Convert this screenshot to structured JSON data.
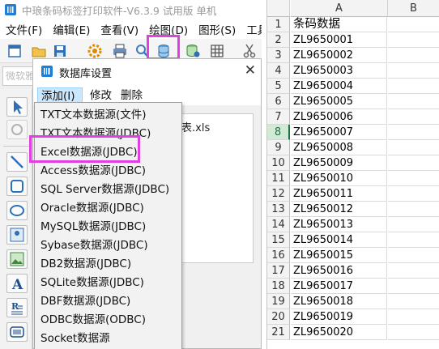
{
  "app": {
    "title": "中琅条码标签打印软件-V6.3.9 试用版 单机",
    "menu": [
      "文件(F)",
      "编辑(E)",
      "查看(V)",
      "绘图(D)",
      "图形(S)",
      "工具"
    ],
    "font_box_text": "微软雅黑"
  },
  "dialog": {
    "title": "数据库设置",
    "close_label": "✕",
    "menu": {
      "add": "添加(I)",
      "modify": "修改",
      "delete": "删除"
    },
    "file_text": "表.xls",
    "dropdown_items": [
      "TXT文本数据源(文件)",
      "TXT文本数据源(JDBC)",
      "Excel数据源(JDBC)",
      "Access数据源(JDBC)",
      "SQL Server数据源(JDBC)",
      "Oracle数据源(JDBC)",
      "MySQL数据源(JDBC)",
      "Sybase数据源(JDBC)",
      "DB2数据源(JDBC)",
      "SQLite数据源(JDBC)",
      "DBF数据源(JDBC)",
      "ODBC数据源(ODBC)",
      "Socket数据源"
    ]
  },
  "sheet": {
    "columns": [
      "A",
      "B"
    ],
    "selected_row": "8",
    "rows": [
      {
        "num": "1",
        "a": "条码数据"
      },
      {
        "num": "2",
        "a": "ZL9650001"
      },
      {
        "num": "3",
        "a": "ZL9650002"
      },
      {
        "num": "4",
        "a": "ZL9650003"
      },
      {
        "num": "5",
        "a": "ZL9650004"
      },
      {
        "num": "6",
        "a": "ZL9650005"
      },
      {
        "num": "7",
        "a": "ZL9650006"
      },
      {
        "num": "8",
        "a": "ZL9650007"
      },
      {
        "num": "9",
        "a": "ZL9650008"
      },
      {
        "num": "10",
        "a": "ZL9650009"
      },
      {
        "num": "11",
        "a": "ZL9650010"
      },
      {
        "num": "12",
        "a": "ZL9650011"
      },
      {
        "num": "13",
        "a": "ZL9650012"
      },
      {
        "num": "14",
        "a": "ZL9650013"
      },
      {
        "num": "15",
        "a": "ZL9650014"
      },
      {
        "num": "16",
        "a": "ZL9650015"
      },
      {
        "num": "17",
        "a": "ZL9650016"
      },
      {
        "num": "18",
        "a": "ZL9650017"
      },
      {
        "num": "19",
        "a": "ZL9650018"
      },
      {
        "num": "20",
        "a": "ZL9650019"
      },
      {
        "num": "21",
        "a": "ZL9650020"
      }
    ]
  },
  "colors": {
    "highlight": "#e040e0",
    "excel_green": "#217346",
    "menu_hover": "#cce8ff"
  },
  "icons": {
    "toolbar": [
      "new-file-icon",
      "open-folder-icon",
      "save-icon",
      "settings-gear-icon",
      "print-icon",
      "preview-icon",
      "database-icon",
      "database-connect-icon",
      "grid-icon",
      "cut-icon"
    ],
    "left_tools": [
      "pointer-icon",
      "rotate-icon",
      "line-icon",
      "rounded-rect-icon",
      "ellipse-icon",
      "image-icon",
      "picture-icon",
      "text-icon",
      "rich-text-icon",
      "barcode-icon"
    ]
  }
}
